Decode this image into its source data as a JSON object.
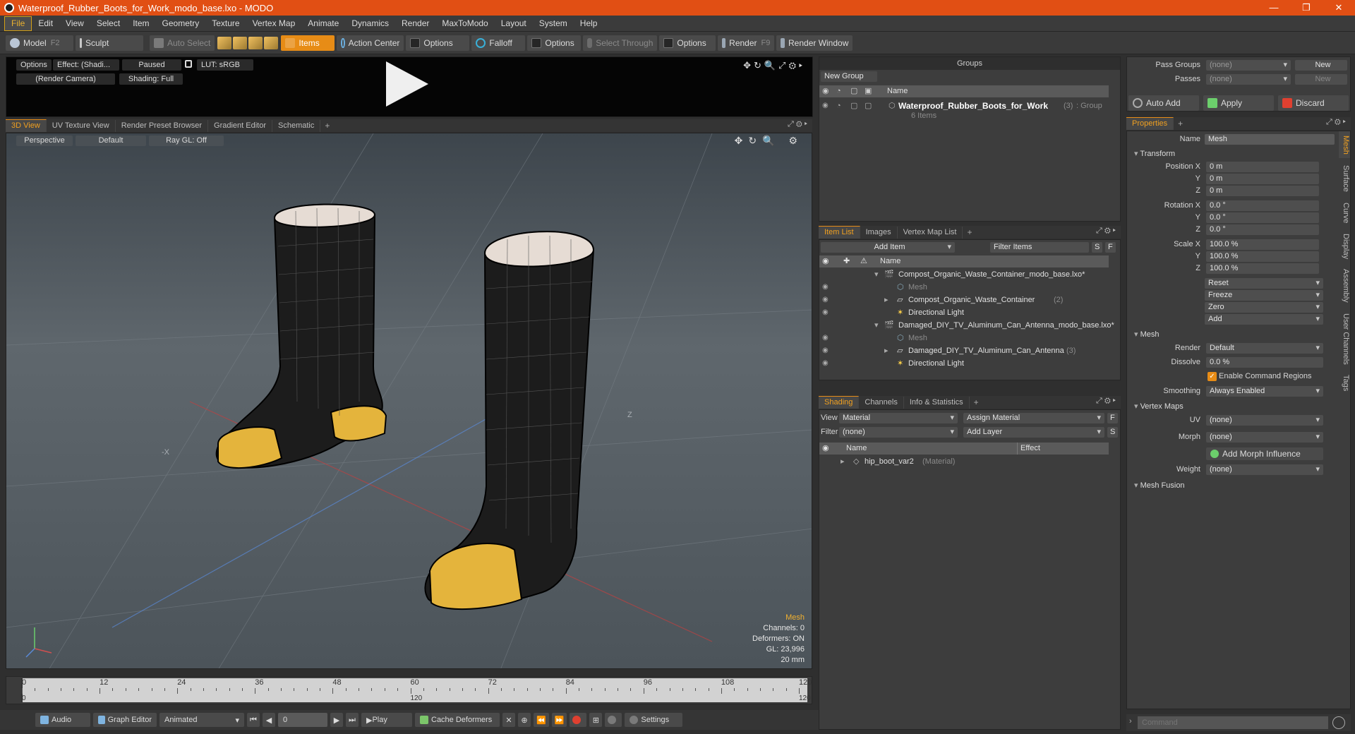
{
  "window": {
    "title": "Waterproof_Rubber_Boots_for_Work_modo_base.lxo - MODO",
    "buttons": [
      "—",
      "❐",
      "✕"
    ]
  },
  "menu": [
    "File",
    "Edit",
    "View",
    "Select",
    "Item",
    "Geometry",
    "Texture",
    "Vertex Map",
    "Animate",
    "Dynamics",
    "Render",
    "MaxToModo",
    "Layout",
    "System",
    "Help"
  ],
  "toolbar": {
    "model": "Model",
    "model_key": "F2",
    "sculpt": "Sculpt",
    "auto_select": "Auto Select",
    "items": "Items",
    "action_center": "Action Center",
    "options1": "Options",
    "falloff": "Falloff",
    "options2": "Options",
    "select_through": "Select Through",
    "options3": "Options",
    "render": "Render",
    "render_key": "F9",
    "render_window": "Render Window"
  },
  "preview": {
    "options": "Options",
    "effect": "Effect: (Shadi...",
    "paused": "Paused",
    "lut": "LUT: sRGB",
    "camera": "(Render Camera)",
    "shading": "Shading: Full"
  },
  "view_tabs": [
    "3D View",
    "UV Texture View",
    "Render Preset Browser",
    "Gradient Editor",
    "Schematic"
  ],
  "viewport": {
    "perspective": "Perspective",
    "default": "Default",
    "raygl": "Ray GL: Off",
    "info": {
      "mesh": "Mesh",
      "channels": "Channels: 0",
      "deformers": "Deformers: ON",
      "gl": "GL: 23,996",
      "scale": "20 mm"
    }
  },
  "timeline": {
    "ticks": [
      "0",
      "12",
      "24",
      "36",
      "48",
      "60",
      "72",
      "84",
      "96",
      "108",
      "120"
    ],
    "bottom_ticks": [
      "0",
      "120",
      "120"
    ]
  },
  "bottombar": {
    "audio": "Audio",
    "graph": "Graph Editor",
    "animated": "Animated",
    "frame": "0",
    "play": "Play",
    "cache": "Cache Deformers",
    "settings": "Settings"
  },
  "groups": {
    "title": "Groups",
    "new_group": "New Group",
    "col_name": "Name",
    "item_name": "Waterproof_Rubber_Boots_for_Work",
    "item_count": "(3)",
    "item_type": ": Group",
    "item_sub": "6 Items"
  },
  "itemlist": {
    "tabs": [
      "Item List",
      "Images",
      "Vertex Map List"
    ],
    "add_item": "Add Item",
    "filter": "Filter Items",
    "s": "S",
    "f": "F",
    "col_name": "Name",
    "rows": [
      {
        "name": "Compost_Organic_Waste_Container_modo_base.lxo*",
        "extra": ""
      },
      {
        "name": "Mesh",
        "extra": ""
      },
      {
        "name": "Compost_Organic_Waste_Container",
        "extra": "(2)"
      },
      {
        "name": "Directional Light",
        "extra": ""
      },
      {
        "name": "Damaged_DIY_TV_Aluminum_Can_Antenna_modo_base.lxo*",
        "extra": ""
      },
      {
        "name": "Mesh",
        "extra": ""
      },
      {
        "name": "Damaged_DIY_TV_Aluminum_Can_Antenna",
        "extra": "(3)"
      },
      {
        "name": "Directional Light",
        "extra": ""
      }
    ]
  },
  "shading": {
    "tabs": [
      "Shading",
      "Channels",
      "Info & Statistics"
    ],
    "view_label": "View",
    "view_value": "Material",
    "assign": "Assign Material",
    "f": "F",
    "filter_label": "Filter",
    "filter_value": "(none)",
    "add_layer": "Add Layer",
    "s": "S",
    "col_name": "Name",
    "col_effect": "Effect",
    "material": "hip_boot_var2",
    "material_type": "(Material)"
  },
  "passes": {
    "pass_groups": "Pass Groups",
    "pass_groups_value": "(none)",
    "new": "New",
    "passes": "Passes",
    "passes_value": "(none)",
    "new2": "New",
    "auto_add": "Auto Add",
    "apply": "Apply",
    "discard": "Discard"
  },
  "properties": {
    "tab": "Properties",
    "name_label": "Name",
    "name_value": "Mesh",
    "transform": "Transform",
    "pos_label": "Position X",
    "rot_label": "Rotation X",
    "scale_label": "Scale X",
    "y": "Y",
    "z": "Z",
    "pos": [
      "0 m",
      "0 m",
      "0 m"
    ],
    "rot": [
      "0.0 °",
      "0.0 °",
      "0.0 °"
    ],
    "scale": [
      "100.0 %",
      "100.0 %",
      "100.0 %"
    ],
    "reset": "Reset",
    "freeze": "Freeze",
    "zero": "Zero",
    "add": "Add",
    "mesh": "Mesh",
    "render_label": "Render",
    "render_value": "Default",
    "dissolve_label": "Dissolve",
    "dissolve_value": "0.0 %",
    "enable_cmd": "Enable Command Regions",
    "smoothing_label": "Smoothing",
    "smoothing_value": "Always Enabled",
    "vertex_maps": "Vertex Maps",
    "uv_label": "UV",
    "uv_value": "(none)",
    "morph_label": "Morph",
    "morph_value": "(none)",
    "add_morph": "Add Morph Influence",
    "weight_label": "Weight",
    "weight_value": "(none)",
    "mesh_fusion": "Mesh Fusion",
    "side_tabs": [
      "Mesh",
      "Surface",
      "Curve",
      "Display",
      "Assembly",
      "User Channels",
      "Tags"
    ]
  },
  "command": {
    "placeholder": "Command"
  }
}
